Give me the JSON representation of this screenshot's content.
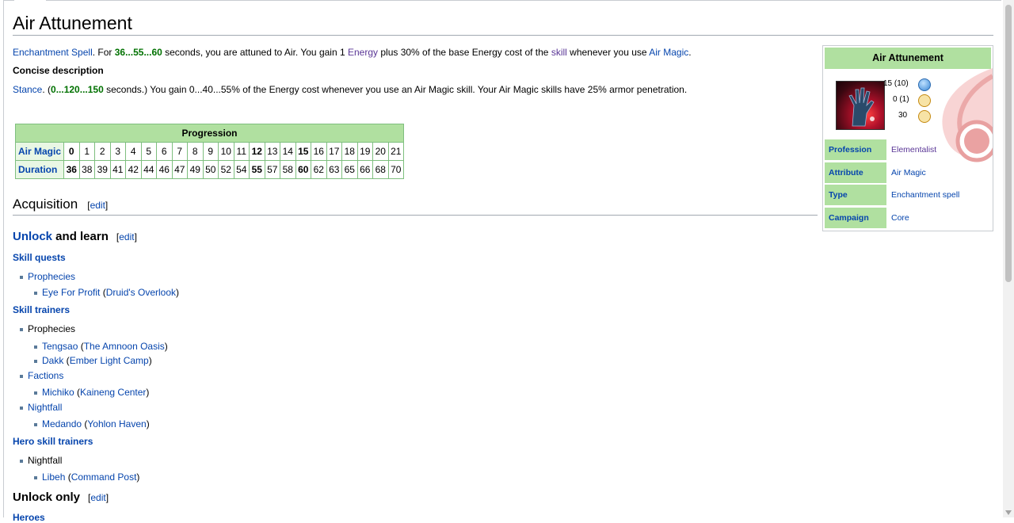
{
  "page": {
    "title": "Air Attunement"
  },
  "description": {
    "link1": "Enchantment Spell",
    "t1": ". For ",
    "vals": "36...55...60",
    "t2": " seconds, you are attuned to Air. You gain 1 ",
    "energy": "Energy",
    "t3": " plus 30% of the base Energy cost of the ",
    "skill": "skill",
    "t4": " whenever you use ",
    "airmagic": "Air Magic",
    "t5": "."
  },
  "concise": {
    "heading": "Concise description",
    "stance": "Stance",
    "t1": ". (",
    "vals": "0...120...150",
    "t2": " seconds.) You gain 0...40...55% of the Energy cost whenever you use an Air Magic skill. Your Air Magic skills have 25% armor penetration."
  },
  "progression": {
    "header": "Progression",
    "rows": [
      {
        "label": "Air Magic",
        "values": [
          "0",
          "1",
          "2",
          "3",
          "4",
          "5",
          "6",
          "7",
          "8",
          "9",
          "10",
          "11",
          "12",
          "13",
          "14",
          "15",
          "16",
          "17",
          "18",
          "19",
          "20",
          "21"
        ]
      },
      {
        "label": "Duration",
        "values": [
          "36",
          "38",
          "39",
          "41",
          "42",
          "44",
          "46",
          "47",
          "49",
          "50",
          "52",
          "54",
          "55",
          "57",
          "58",
          "60",
          "62",
          "63",
          "65",
          "66",
          "68",
          "70"
        ]
      }
    ],
    "bold_index": [
      0,
      12,
      15
    ]
  },
  "acquisition": {
    "heading": "Acquisition",
    "edit": "edit",
    "unlock_learn_link": "Unlock",
    "unlock_learn_rest": " and learn",
    "skill_quests": "Skill quests",
    "prophecies_q": "Prophecies",
    "eye_for_profit": "Eye For Profit",
    "druids_overlook": "Druid's Overlook",
    "skill_trainers": "Skill trainers",
    "prophecies_t": "Prophecies",
    "tengsao": "Tengsao",
    "amnoon": "The Amnoon Oasis",
    "dakk": "Dakk",
    "ember": "Ember Light Camp",
    "factions": "Factions",
    "michiko": "Michiko",
    "kaineng": "Kaineng Center",
    "nightfall": "Nightfall",
    "medando": "Medando",
    "yohlon": "Yohlon Haven",
    "hero_trainers": "Hero skill trainers",
    "nightfall_h": "Nightfall",
    "libeh": "Libeh",
    "command_post": "Command Post",
    "unlock_only": "Unlock only",
    "heroes": "Heroes"
  },
  "infobox": {
    "title": "Air Attunement",
    "energy": "15 (10)",
    "activation": "0 (1)",
    "recharge": "30",
    "rows": [
      {
        "key": "Profession",
        "value": "Elementalist"
      },
      {
        "key": "Attribute",
        "value": "Air Magic"
      },
      {
        "key": "Type",
        "value": "Enchantment spell"
      },
      {
        "key": "Campaign",
        "value": "Core"
      }
    ]
  },
  "colors": {
    "link": "#0645ad",
    "visited": "#5a3696",
    "green_value": "#007100",
    "table_header": "#b0e0a0"
  }
}
